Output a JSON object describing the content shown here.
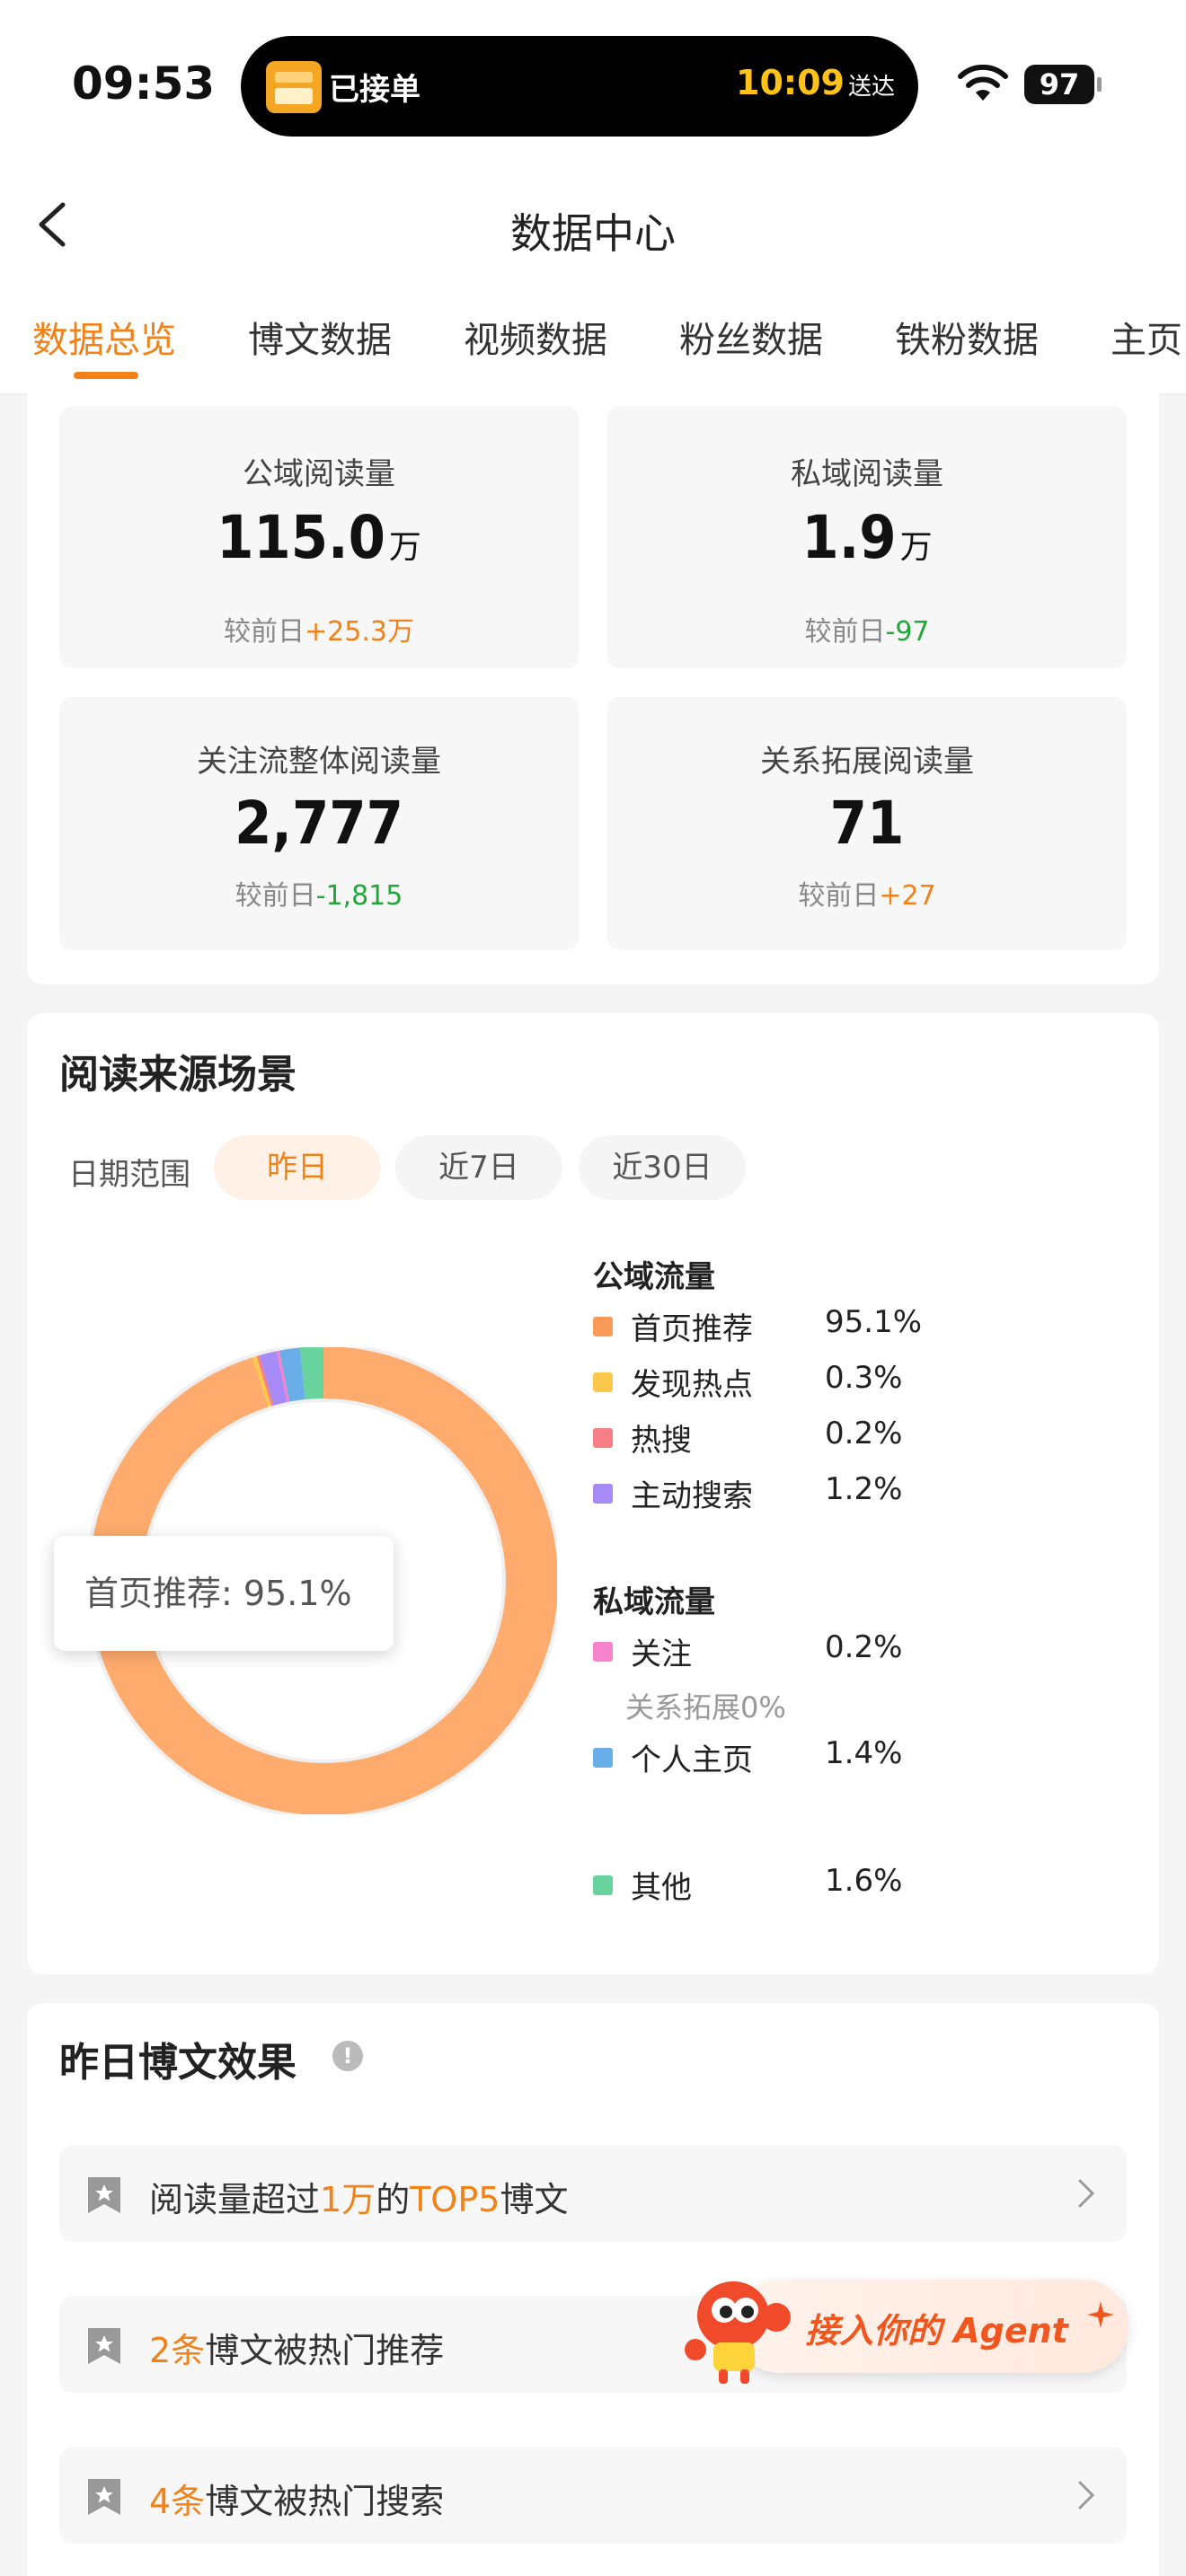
{
  "status_bar": {
    "time": "09:53",
    "island_text": "已接单",
    "eta_time": "10:09",
    "eta_suffix": "送达",
    "battery": "97"
  },
  "header": {
    "title": "数据中心",
    "tabs": [
      "数据总览",
      "博文数据",
      "视频数据",
      "粉丝数据",
      "铁粉数据",
      "主页"
    ]
  },
  "metrics": [
    {
      "label": "公域阅读量",
      "value": "115.0",
      "unit": "万",
      "compare_prefix": "较前日",
      "delta": "+25.3万"
    },
    {
      "label": "私域阅读量",
      "value": "1.9",
      "unit": "万",
      "compare_prefix": "较前日",
      "delta": "-97"
    },
    {
      "label": "关注流整体阅读量",
      "value": "2,777",
      "unit": "",
      "compare_prefix": "较前日",
      "delta": "-1,815"
    },
    {
      "label": "关系拓展阅读量",
      "value": "71",
      "unit": "",
      "compare_prefix": "较前日",
      "delta": "+27"
    }
  ],
  "source_section": {
    "title": "阅读来源场景",
    "date_label": "日期范围",
    "pills": [
      "昨日",
      "近7日",
      "近30日"
    ],
    "tooltip": "首页推荐: 95.1%",
    "public_head": "公域流量",
    "private_head": "私域流量",
    "public_items": [
      {
        "name": "首页推荐",
        "value": "95.1%",
        "color": "#f99a59"
      },
      {
        "name": "发现热点",
        "value": "0.3%",
        "color": "#fcc94d"
      },
      {
        "name": "热搜",
        "value": "0.2%",
        "color": "#f87e86"
      },
      {
        "name": "主动搜索",
        "value": "1.2%",
        "color": "#a68af5"
      }
    ],
    "private_items": [
      {
        "name": "关注",
        "value": "0.2%",
        "color": "#f783cf"
      },
      {
        "name": "个人主页",
        "value": "1.4%",
        "color": "#6aaee9"
      }
    ],
    "private_note": "关系拓展0%",
    "other_item": {
      "name": "其他",
      "value": "1.6%",
      "color": "#68d39c"
    }
  },
  "chart_data": {
    "type": "pie",
    "categories": [
      "首页推荐",
      "发现热点",
      "热搜",
      "主动搜索",
      "关注",
      "关系拓展",
      "个人主页",
      "其他"
    ],
    "values": [
      95.1,
      0.3,
      0.2,
      1.2,
      0.2,
      0,
      1.4,
      1.6
    ],
    "colors": [
      "#ffab6e",
      "#fcc94d",
      "#f87e86",
      "#a68af5",
      "#f783cf",
      "#cccccc",
      "#6aaee9",
      "#68d39c"
    ]
  },
  "post_section": {
    "title": "昨日博文效果",
    "rows": [
      {
        "parts": [
          "阅读量超过",
          "1万",
          "的",
          "TOP5",
          "博文"
        ]
      },
      {
        "parts": [
          "",
          "2条",
          "博文被热门推荐",
          "",
          ""
        ]
      },
      {
        "parts": [
          "",
          "4条",
          "博文被热门搜索",
          "",
          ""
        ]
      }
    ]
  },
  "agent_button": {
    "label": "接入你的 Agent"
  }
}
